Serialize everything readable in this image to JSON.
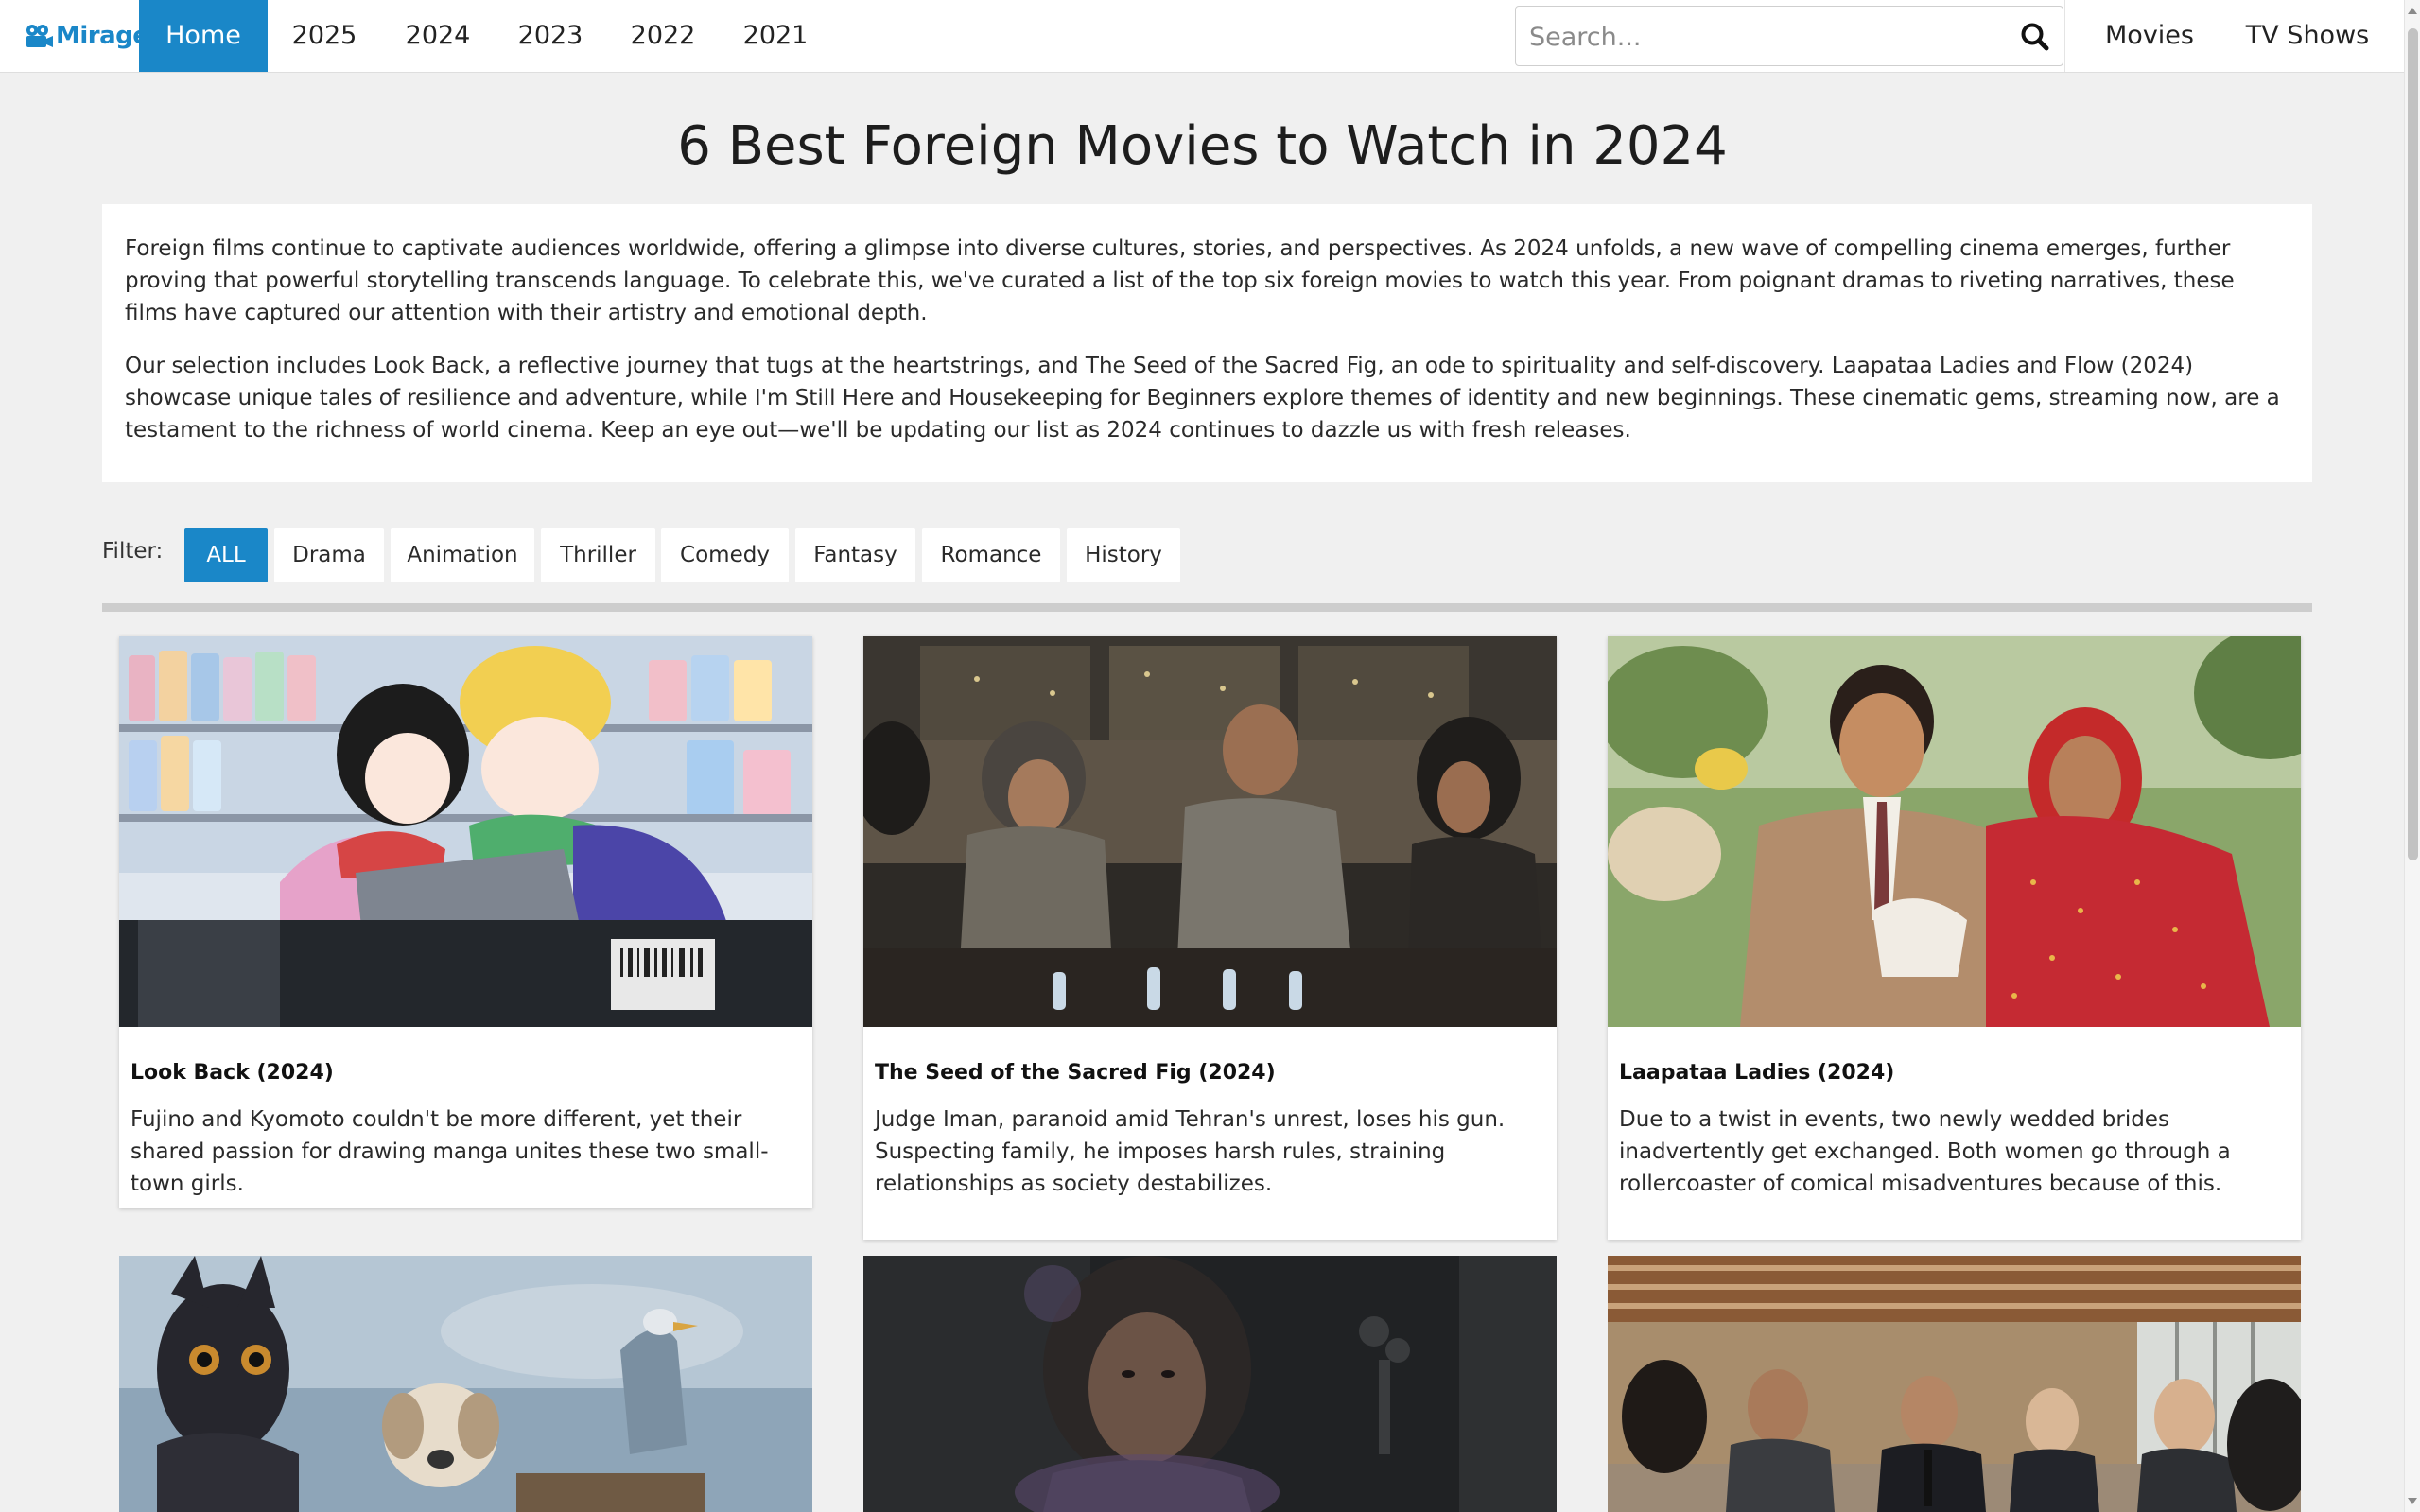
{
  "nav": {
    "logo_text": "Mirage",
    "links": [
      "Home",
      "2025",
      "2024",
      "2023",
      "2022",
      "2021"
    ],
    "active_link": "Home",
    "search_placeholder": "Search...",
    "right_links": [
      "Movies",
      "TV Shows"
    ]
  },
  "page": {
    "title": "6 Best Foreign Movies to Watch in 2024",
    "intro_paragraphs": [
      "Foreign films continue to captivate audiences worldwide, offering a glimpse into diverse cultures, stories, and perspectives. As 2024 unfolds, a new wave of compelling cinema emerges, further proving that powerful storytelling transcends language. To celebrate this, we've curated a list of the top six foreign movies to watch this year. From poignant dramas to riveting narratives, these films have captured our attention with their artistry and emotional depth.",
      "Our selection includes Look Back, a reflective journey that tugs at the heartstrings, and The Seed of the Sacred Fig, an ode to spirituality and self-discovery. Laapataa Ladies and Flow (2024) showcase unique tales of resilience and adventure, while I'm Still Here and Housekeeping for Beginners explore themes of identity and new beginnings. These cinematic gems, streaming now, are a testament to the richness of world cinema. Keep an eye out—we'll be updating our list as 2024 continues to dazzle us with fresh releases."
    ]
  },
  "filter": {
    "label": "Filter:",
    "options": [
      "ALL",
      "Drama",
      "Animation",
      "Thriller",
      "Comedy",
      "Fantasy",
      "Romance",
      "History"
    ],
    "active": "ALL"
  },
  "movies": [
    {
      "title": "Look Back (2024)",
      "description": "Fujino and Kyomoto couldn't be more different, yet their shared passion for drawing manga unites these two small-town girls."
    },
    {
      "title": "The Seed of the Sacred Fig (2024)",
      "description": "Judge Iman, paranoid amid Tehran's unrest, loses his gun. Suspecting family, he imposes harsh rules, straining relationships as society destabilizes."
    },
    {
      "title": "Laapataa Ladies (2024)",
      "description": "Due to a twist in events, two newly wedded brides inadvertently get exchanged. Both women go through a rollercoaster of comical misadventures because of this."
    },
    {
      "title": "",
      "description": ""
    },
    {
      "title": "",
      "description": ""
    },
    {
      "title": "",
      "description": ""
    }
  ],
  "colors": {
    "accent": "#1a87c8",
    "page_bg": "#f0f0f0",
    "card_bg": "#ffffff",
    "rule": "#cdcdcd"
  }
}
